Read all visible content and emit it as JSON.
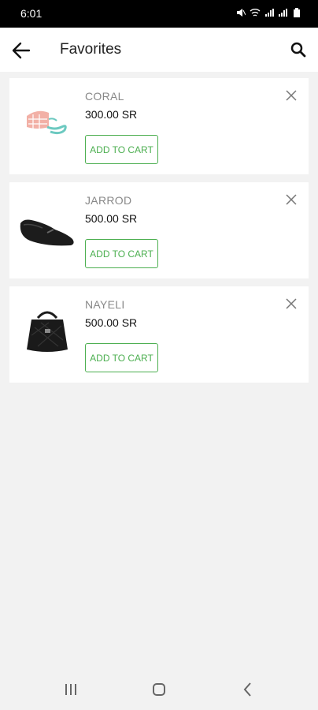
{
  "status": {
    "time": "6:01"
  },
  "header": {
    "title": "Favorites",
    "back_icon": "arrow-left-icon",
    "search_icon": "search-icon"
  },
  "items": [
    {
      "name": "CORAL",
      "price": "300.00 SR",
      "button": "ADD TO CART",
      "image": "bag-icon"
    },
    {
      "name": "JARROD",
      "price": "500.00 SR",
      "button": "ADD TO CART",
      "image": "loafer-icon"
    },
    {
      "name": "NAYELI",
      "price": "500.00 SR",
      "button": "ADD TO CART",
      "image": "handbag-icon"
    }
  ],
  "colors": {
    "accent": "#4caf50",
    "background": "#f2f2f2"
  },
  "nav": {
    "recent": "recent-apps-icon",
    "home": "home-icon",
    "back": "back-icon"
  }
}
